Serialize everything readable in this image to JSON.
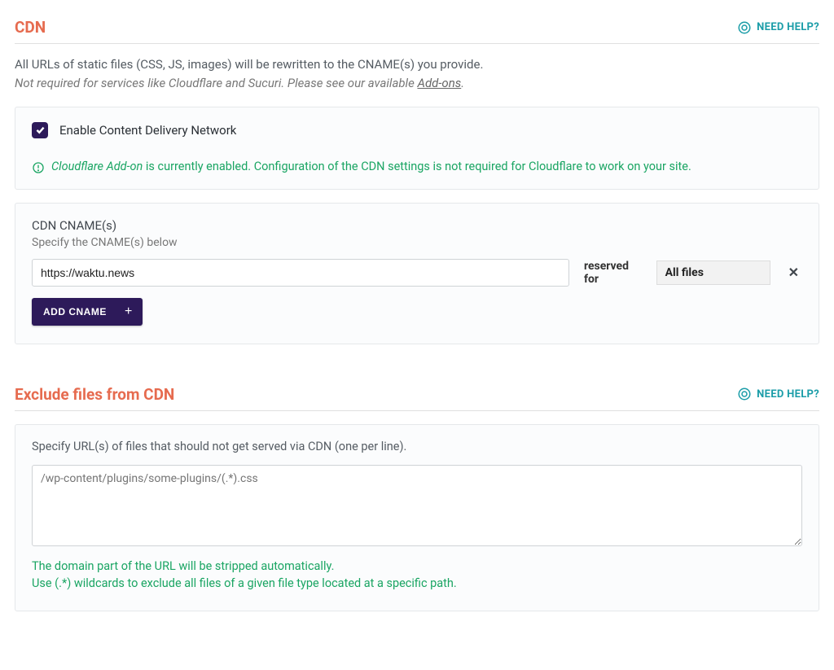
{
  "help": {
    "label": "NEED HELP?"
  },
  "cdn": {
    "title": "CDN",
    "desc1": "All URLs of static files (CSS, JS, images) will be rewritten to the CNAME(s) you provide.",
    "desc2_prefix": "Not required for services like Cloudflare and Sucuri. Please see our available ",
    "desc2_link": "Add-ons",
    "desc2_suffix": ".",
    "checkbox_label": "Enable Content Delivery Network",
    "info_lead": "Cloudflare Add-on",
    "info_rest": " is currently enabled. Configuration of the CDN settings is not required for Cloudflare to work on your site.",
    "cname_title": "CDN CNAME(s)",
    "cname_sub": "Specify the CNAME(s) below",
    "cname_value": "https://waktu.news",
    "reserved_label": "reserved for",
    "reserved_value": "All files",
    "add_label": "ADD CNAME"
  },
  "exclude": {
    "title": "Exclude files from CDN",
    "desc": "Specify URL(s) of files that should not get served via CDN (one per line).",
    "placeholder": "/wp-content/plugins/some-plugins/(.*).css",
    "hint1": "The domain part of the URL will be stripped automatically.",
    "hint2": "Use (.*) wildcards to exclude all files of a given file type located at a specific path."
  }
}
